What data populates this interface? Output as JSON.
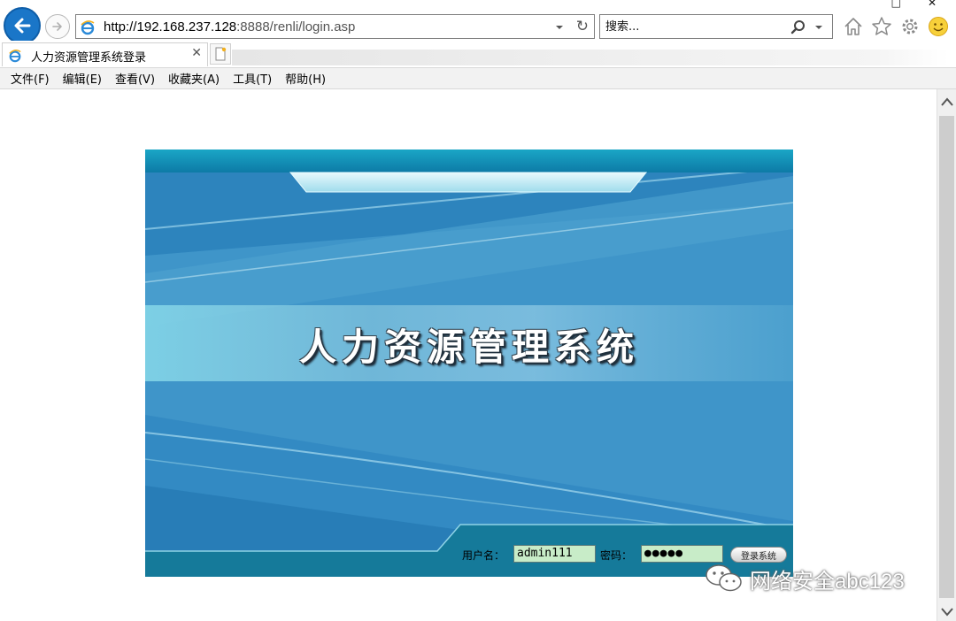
{
  "browser": {
    "url_host": "http://192.168.237.128",
    "url_path": ":8888/renli/login.asp",
    "search_placeholder": "搜索...",
    "tab_title": "人力资源管理系统登录",
    "menu": [
      "文件(F)",
      "编辑(E)",
      "查看(V)",
      "收藏夹(A)",
      "工具(T)",
      "帮助(H)"
    ],
    "window_controls": [
      "□",
      "✕"
    ]
  },
  "page": {
    "system_title": "人力资源管理系统",
    "username_label": "用户名：",
    "username_value": "admin111",
    "password_label": "密码：",
    "password_value": "●●●●●",
    "login_button": "登录系统"
  },
  "watermark": {
    "text": "网络安全abc123"
  },
  "colors": {
    "accent": "#1a76c8",
    "banner_blue": "#3e8ec4",
    "banner_dark": "#157a9a",
    "field_bg": "#c8ecc8"
  },
  "icons": [
    "back-arrow-icon",
    "forward-arrow-icon",
    "ie-logo-icon",
    "dropdown-icon",
    "refresh-icon",
    "search-icon",
    "home-icon",
    "star-icon",
    "gear-icon",
    "smiley-icon",
    "close-icon",
    "new-tab-icon",
    "wechat-icon"
  ]
}
